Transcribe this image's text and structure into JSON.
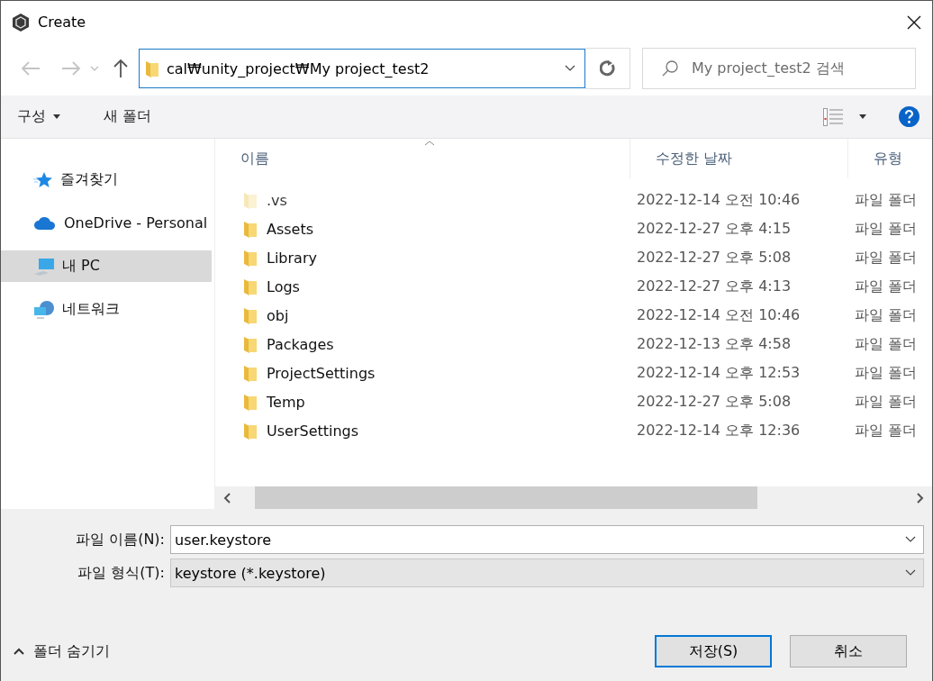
{
  "window": {
    "title": "Create"
  },
  "address": {
    "value": "cal₩unity_project₩My project_test2"
  },
  "search": {
    "placeholder": "My project_test2 검색"
  },
  "commands": [
    {
      "label": "구성",
      "kind": "menu"
    },
    {
      "label": "새 폴더",
      "kind": "plain"
    }
  ],
  "sidebar": {
    "items": [
      {
        "label": "즐겨찾기",
        "kind": "star",
        "selected": false
      },
      {
        "label": "OneDrive - Personal",
        "kind": "cloud",
        "selected": false
      },
      {
        "label": "내 PC",
        "kind": "pc",
        "selected": true
      },
      {
        "label": "네트워크",
        "kind": "network",
        "selected": false
      }
    ]
  },
  "table": {
    "columns": [
      "이름",
      "수정한 날짜",
      "유형"
    ],
    "rows": [
      {
        "name": ".vs",
        "date": "2022-12-14 오전 10:46",
        "type": "파일 폴더",
        "hidden": true
      },
      {
        "name": "Assets",
        "date": "2022-12-27 오후 4:15",
        "type": "파일 폴더",
        "hidden": false
      },
      {
        "name": "Library",
        "date": "2022-12-27 오후 5:08",
        "type": "파일 폴더",
        "hidden": false
      },
      {
        "name": "Logs",
        "date": "2022-12-27 오후 4:13",
        "type": "파일 폴더",
        "hidden": false
      },
      {
        "name": "obj",
        "date": "2022-12-14 오전 10:46",
        "type": "파일 폴더",
        "hidden": false
      },
      {
        "name": "Packages",
        "date": "2022-12-13 오후 4:58",
        "type": "파일 폴더",
        "hidden": false
      },
      {
        "name": "ProjectSettings",
        "date": "2022-12-14 오후 12:53",
        "type": "파일 폴더",
        "hidden": false
      },
      {
        "name": "Temp",
        "date": "2022-12-27 오후 5:08",
        "type": "파일 폴더",
        "hidden": false
      },
      {
        "name": "UserSettings",
        "date": "2022-12-14 오후 12:36",
        "type": "파일 폴더",
        "hidden": false
      }
    ]
  },
  "file_name": {
    "label": "파일 이름(N):",
    "value": "user.keystore"
  },
  "file_type": {
    "label": "파일 형식(T):",
    "value": "keystore (*.keystore)"
  },
  "hide_folders": {
    "label": "폴더 숨기기"
  },
  "buttons": [
    {
      "label": "저장(S)",
      "kind": "default"
    },
    {
      "label": "취소",
      "kind": "normal"
    }
  ]
}
